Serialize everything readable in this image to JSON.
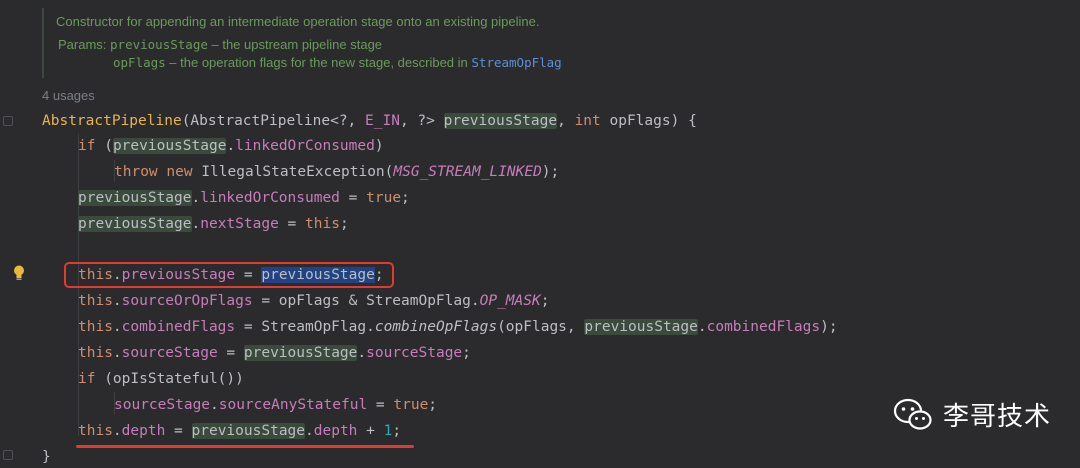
{
  "doc": {
    "summary": "Constructor for appending an intermediate operation stage onto an existing pipeline.",
    "params_label": "Params:",
    "p1_name": "previousStage",
    "p1_desc": " – the upstream pipeline stage",
    "p2_name": "opFlags",
    "p2_desc": " – the operation flags for the new stage, described in ",
    "p2_link": "StreamOpFlag"
  },
  "usages": "4 usages",
  "code": {
    "l1": {
      "decl": "AbstractPipeline",
      "a": "(AbstractPipeline<?, ",
      "tp": "E_IN",
      "b": ", ?> ",
      "param": "previousStage",
      "c": ", ",
      "kw": "int",
      "d": " opFlags) {"
    },
    "l2": {
      "kw": "if",
      "a": " (",
      "param": "previousStage",
      "b": ".",
      "fld": "linkedOrConsumed",
      "c": ")"
    },
    "l3": {
      "kw1": "throw",
      "kw2": "new",
      "a": " IllegalStateException(",
      "cst": "MSG_STREAM_LINKED",
      "b": ");"
    },
    "l4": {
      "param": "previousStage",
      "a": ".",
      "fld": "linkedOrConsumed",
      "b": " = ",
      "kw": "true",
      "c": ";"
    },
    "l5": {
      "param": "previousStage",
      "a": ".",
      "fld": "nextStage",
      "b": " = ",
      "kw": "this",
      "c": ";"
    },
    "l6": {
      "kw": "this",
      "a": ".",
      "fld": "previousStage",
      "b": " = ",
      "sel": "previousStage",
      "c": ";"
    },
    "l7": {
      "kw": "this",
      "a": ".",
      "fld": "sourceOrOpFlags",
      "b": " = opFlags & StreamOpFlag.",
      "cst": "OP_MASK",
      "c": ";"
    },
    "l8": {
      "kw": "this",
      "a": ".",
      "fld": "combinedFlags",
      "b": " = StreamOpFlag.",
      "ital": "combineOpFlags",
      "c": "(opFlags, ",
      "param": "previousStage",
      "d": ".",
      "fld2": "combinedFlags",
      "e": ");"
    },
    "l9": {
      "kw": "this",
      "a": ".",
      "fld": "sourceStage",
      "b": " = ",
      "param": "previousStage",
      "c": ".",
      "fld2": "sourceStage",
      "d": ";"
    },
    "l10": {
      "kw": "if",
      "a": " (opIsStateful())"
    },
    "l11": {
      "fld1": "sourceStage",
      "a": ".",
      "fld2": "sourceAnyStateful",
      "b": " = ",
      "kw": "true",
      "c": ";"
    },
    "l12": {
      "kw": "this",
      "a": ".",
      "fld": "depth",
      "b": " = ",
      "param": "previousStage",
      "c": ".",
      "fld2": "depth",
      "d": " + ",
      "num": "1",
      "e": ";"
    },
    "l13": {
      "a": "}"
    }
  },
  "watermark": {
    "text": "李哥技术",
    "icon": "wechat-icon"
  },
  "colors": {
    "background": "#2b2b2d",
    "keyword": "#cf8e6d",
    "field": "#c77dbb",
    "highlight": "#e23b2e",
    "selection": "#214283"
  }
}
